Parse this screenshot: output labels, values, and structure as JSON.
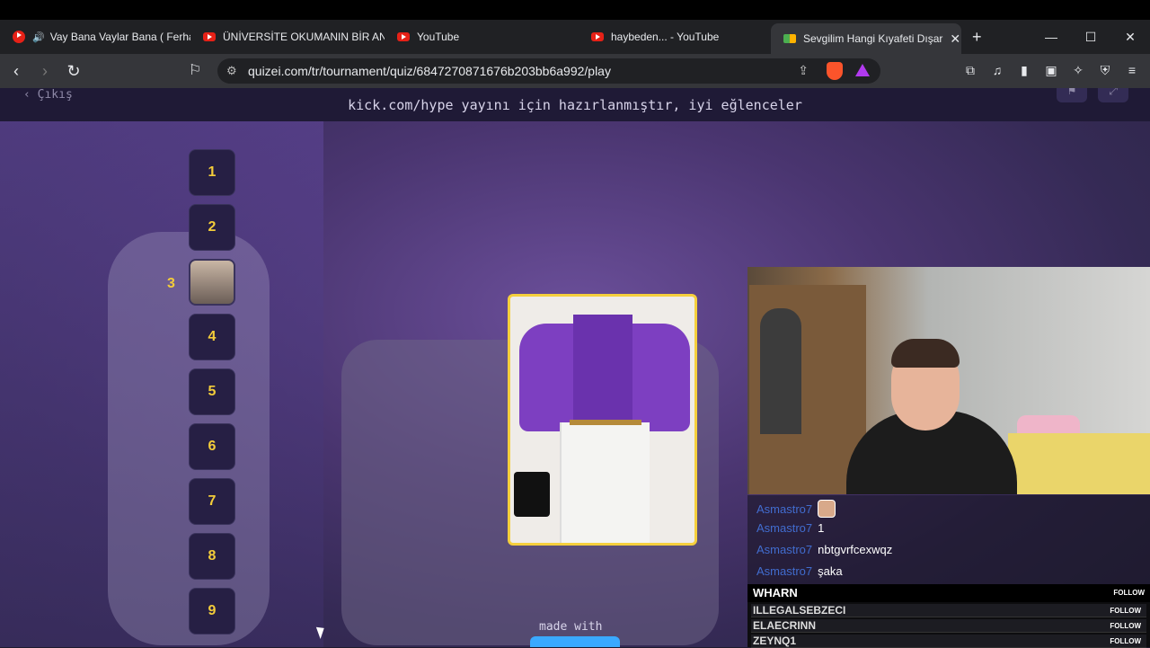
{
  "browser": {
    "tabs": [
      {
        "title": "Vay Bana Vaylar Bana ( Ferhat",
        "audio": true
      },
      {
        "title": "ÜNİVERSİTE OKUMANIN BİR ANL"
      },
      {
        "title": "YouTube"
      },
      {
        "title": "haybeden... - YouTube"
      },
      {
        "title": "Sevgilim Hangi Kıyafeti Dışar",
        "active": true
      }
    ],
    "new_tab": "+",
    "url": "quizei.com/tr/tournament/quiz/6847270871676b203bb6a992/play",
    "window_controls": {
      "minimize": "—",
      "maximize": "☐",
      "close": "✕"
    }
  },
  "page": {
    "exit_label": "Çıkış",
    "subtitle": "kick.com/hype yayını için hazırlanmıştır, iyi eğlenceler",
    "slots": [
      "1",
      "2",
      "3",
      "4",
      "5",
      "6",
      "7",
      "8",
      "9"
    ],
    "current_slot_label": "3",
    "made_with": "made with"
  },
  "chat": {
    "messages": [
      {
        "user": "Asmastro7",
        "text": ""
      },
      {
        "user": "Asmastro7",
        "text": "1"
      },
      {
        "user": "Asmastro7",
        "text": "nbtgvrfcexwqz"
      },
      {
        "user": "Asmastro7",
        "text": "şaka"
      }
    ]
  },
  "follows": {
    "header": "WHARN",
    "button": "FOLLOW",
    "items": [
      "ILLEGALSEBZECI",
      "ELAECRINN",
      "ZEYNQ1"
    ]
  }
}
